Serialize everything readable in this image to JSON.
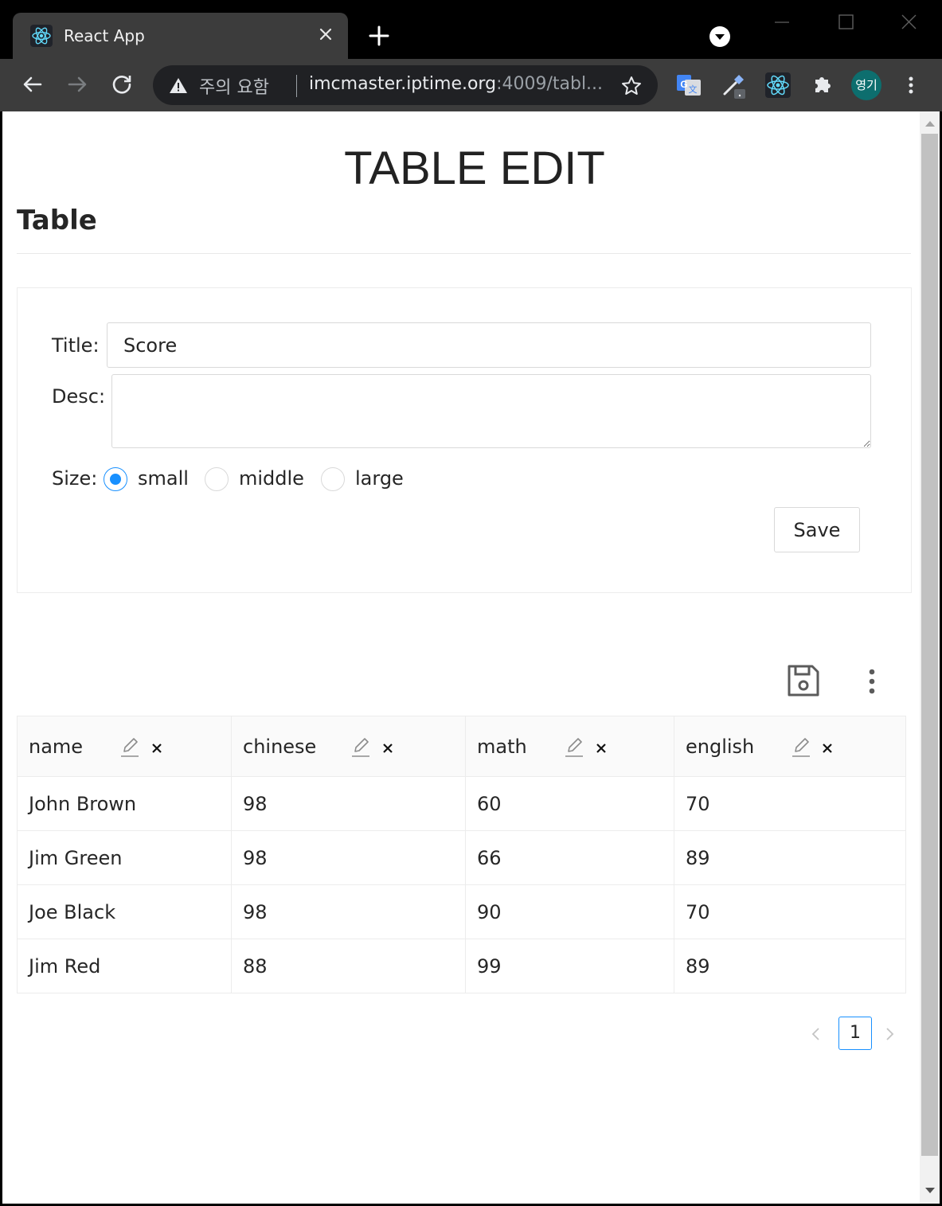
{
  "browser": {
    "tab_title": "React App",
    "security_text": "주의 요함",
    "url_host": "imcmaster.iptime.org",
    "url_path": ":4009/tabl...",
    "profile_initials": "영기"
  },
  "page": {
    "heading": "TABLE EDIT",
    "section_title": "Table"
  },
  "form": {
    "title_label": "Title",
    "title_value": "Score",
    "desc_label": "Desc",
    "desc_value": "",
    "size_label": "Size",
    "size_options": [
      "small",
      "middle",
      "large"
    ],
    "size_selected": "small",
    "save_label": "Save"
  },
  "table": {
    "columns": [
      "name",
      "chinese",
      "math",
      "english"
    ],
    "rows": [
      [
        "John Brown",
        "98",
        "60",
        "70"
      ],
      [
        "Jim Green",
        "98",
        "66",
        "89"
      ],
      [
        "Joe Black",
        "98",
        "90",
        "70"
      ],
      [
        "Jim Red",
        "88",
        "99",
        "89"
      ]
    ]
  },
  "pagination": {
    "current_page": "1"
  },
  "colors": {
    "accent": "#1890ff",
    "chrome_dark": "#3c3c3c",
    "omnibox": "#202124"
  }
}
